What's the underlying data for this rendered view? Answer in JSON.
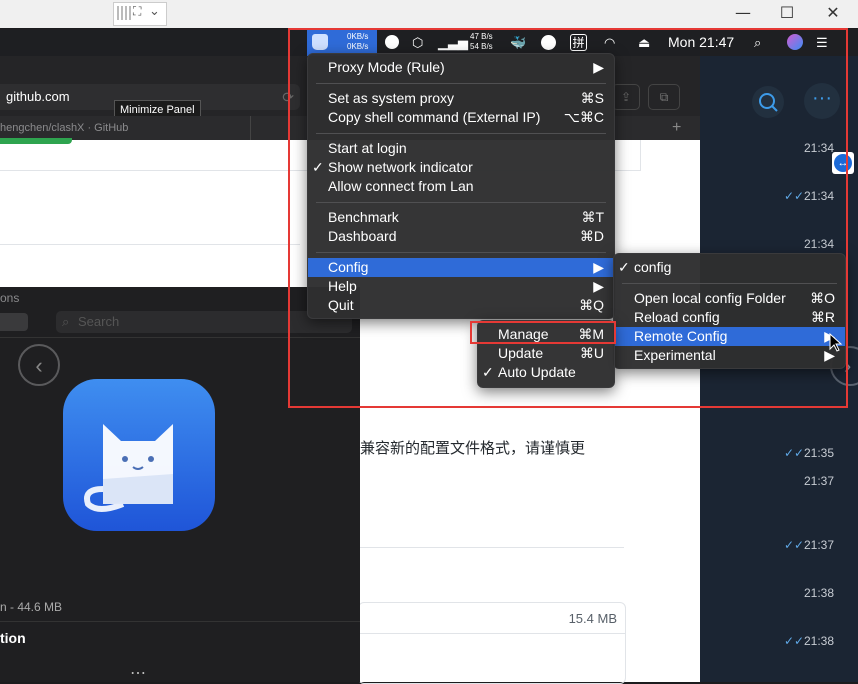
{
  "window": {
    "minimize": "—",
    "maximize": "☐",
    "close": "✕"
  },
  "menubar": {
    "net_up": "0KB/s",
    "net_down": "0KB/s",
    "speed_up": "47 B/s",
    "speed_down": "54 B/s",
    "input_method": "拼",
    "clock": "Mon 21:47"
  },
  "browser": {
    "url": "github.com",
    "tooltip": "Minimize Panel",
    "tab_title": "hengchen/clashX · GitHub",
    "chinese_text": "兼容新的配置文件格式，请谨慎更",
    "file_size": "15.4 MB"
  },
  "store": {
    "header": "ons",
    "search_placeholder": "Search",
    "size_text": "n - 44.6 MB",
    "section": "tion",
    "more": "⋯"
  },
  "chat": {
    "times": [
      "21:34",
      "21:34",
      "21:34",
      "21:35",
      "21:37",
      "21:37",
      "21:38",
      "21:38"
    ],
    "check_glyph": "✓✓"
  },
  "menu_main": {
    "proxy_mode": "Proxy Mode (Rule)",
    "set_system_proxy": "Set as system proxy",
    "set_system_proxy_sc": "⌘S",
    "copy_shell": "Copy shell command (External IP)",
    "copy_shell_sc": "⌥⌘C",
    "start_login": "Start at login",
    "show_network": "Show network indicator",
    "allow_lan": "Allow connect from Lan",
    "benchmark": "Benchmark",
    "benchmark_sc": "⌘T",
    "dashboard": "Dashboard",
    "dashboard_sc": "⌘D",
    "config": "Config",
    "help": "Help",
    "quit": "Quit",
    "quit_sc": "⌘Q",
    "arrow": "▶",
    "check": "✓"
  },
  "menu_config": {
    "config": "config",
    "open_folder": "Open local config Folder",
    "open_folder_sc": "⌘O",
    "reload": "Reload config",
    "reload_sc": "⌘R",
    "remote": "Remote Config",
    "experimental": "Experimental"
  },
  "menu_remote": {
    "manage": "Manage",
    "manage_sc": "⌘M",
    "update": "Update",
    "update_sc": "⌘U",
    "auto_update": "Auto Update"
  },
  "colors": {
    "highlight": "#2f6bd8",
    "annotation": "#e53935"
  }
}
